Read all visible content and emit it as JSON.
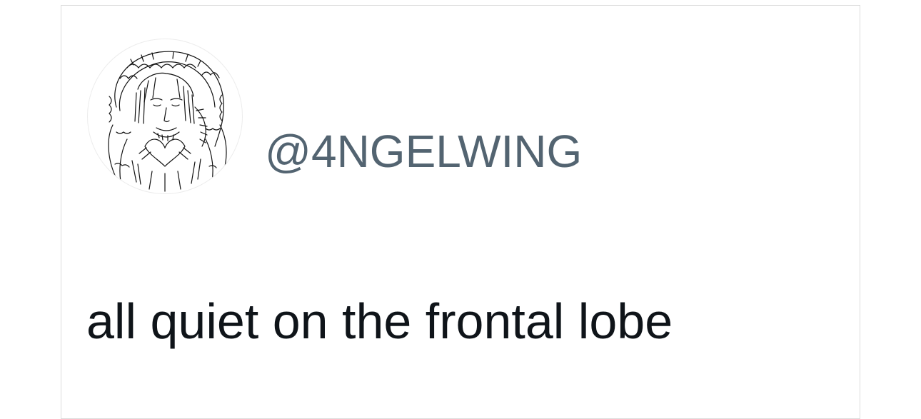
{
  "tweet": {
    "avatar_icon": "sketched-portrait-avatar",
    "handle": "@4NGELWING",
    "text": "all quiet on the frontal lobe"
  },
  "colors": {
    "handle": "#536471",
    "text": "#0f1419",
    "border": "#dcdcdc"
  }
}
